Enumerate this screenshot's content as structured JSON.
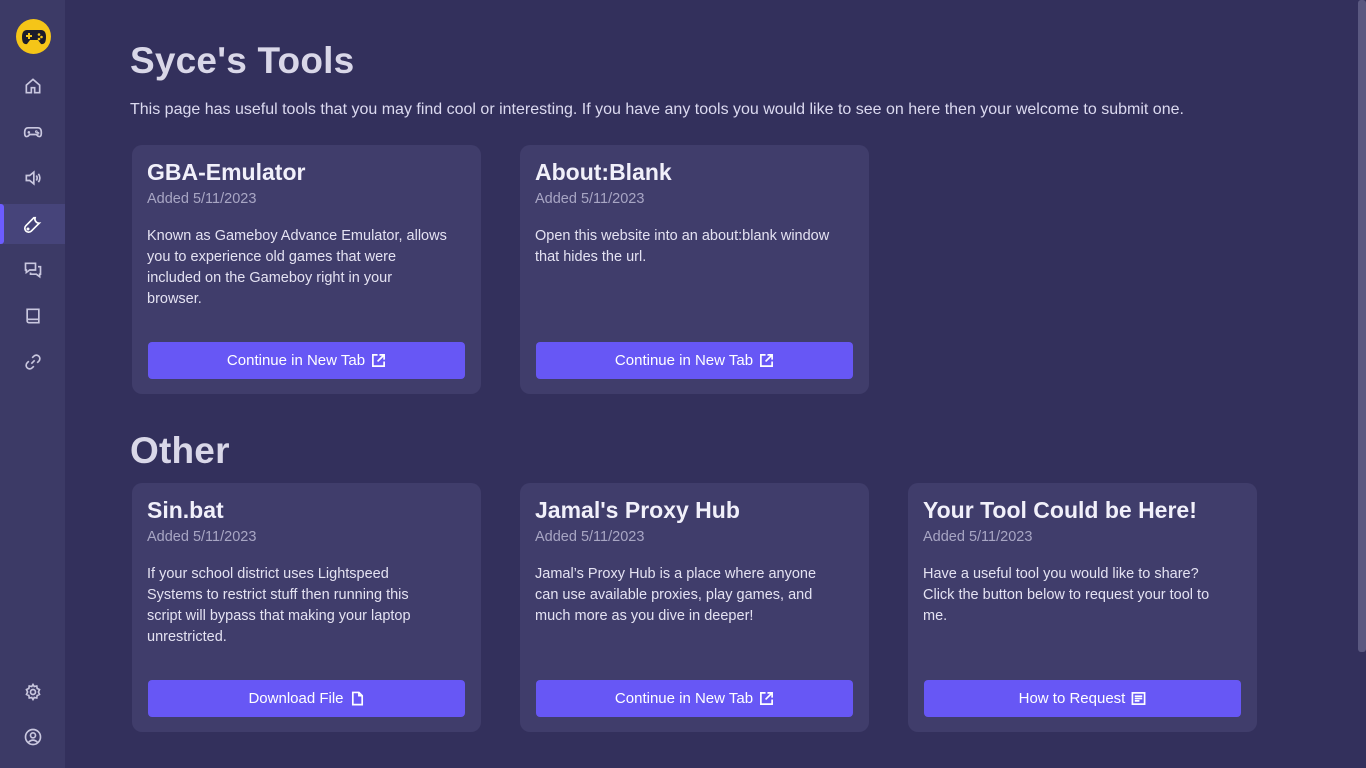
{
  "sidebar": {
    "logo_icon": "gamepad-logo",
    "items": [
      {
        "name": "home",
        "icon": "home-icon"
      },
      {
        "name": "games",
        "icon": "gamepad-icon"
      },
      {
        "name": "audio",
        "icon": "speaker-icon"
      },
      {
        "name": "tools",
        "icon": "wrench-icon",
        "active": true
      },
      {
        "name": "chat",
        "icon": "chat-icon"
      },
      {
        "name": "book",
        "icon": "book-icon"
      },
      {
        "name": "links",
        "icon": "link-icon"
      },
      {
        "name": "settings",
        "icon": "gear-icon"
      },
      {
        "name": "account",
        "icon": "user-circle-icon"
      }
    ],
    "accent": "#6c5cff"
  },
  "tools_section": {
    "title": "Syce's Tools",
    "intro": "This page has useful tools that you may find cool or interesting. If you have any tools you would like to see on here then your welcome to submit one.",
    "cards": [
      {
        "title": "GBA-Emulator",
        "date": "Added 5/11/2023",
        "description": "Known as Gameboy Advance Emulator, allows you to experience old games that were included on the Gameboy right in your browser.",
        "button": "Continue in New Tab",
        "button_icon": "external-link-icon"
      },
      {
        "title": "About:Blank",
        "date": "Added 5/11/2023",
        "description": "Open this website into an about:blank window that hides the url.",
        "button": "Continue in New Tab",
        "button_icon": "external-link-icon"
      }
    ]
  },
  "other_section": {
    "title": "Other",
    "cards": [
      {
        "title": "Sin.bat",
        "date": "Added 5/11/2023",
        "description": "If your school district uses Lightspeed Systems to restrict stuff then running this script will bypass that making your laptop unrestricted.",
        "button": "Download File",
        "button_icon": "file-icon"
      },
      {
        "title": "Jamal's Proxy Hub",
        "date": "Added 5/11/2023",
        "description": "Jamal’s Proxy Hub is a place where anyone can use available proxies, play games, and much more as you dive in deeper!",
        "button": "Continue in New Tab",
        "button_icon": "external-link-icon"
      },
      {
        "title": "Your Tool Could be Here!",
        "date": "Added 5/11/2023",
        "description": "Have a useful tool you would like to share? Click the button below to request your tool to me.",
        "button": "How to Request",
        "button_icon": "document-lines-icon"
      }
    ]
  },
  "colors": {
    "background": "#33305c",
    "sidebar": "#3c3a66",
    "card": "#403d6b",
    "button": "#6757f5",
    "logo": "#f5c518"
  }
}
